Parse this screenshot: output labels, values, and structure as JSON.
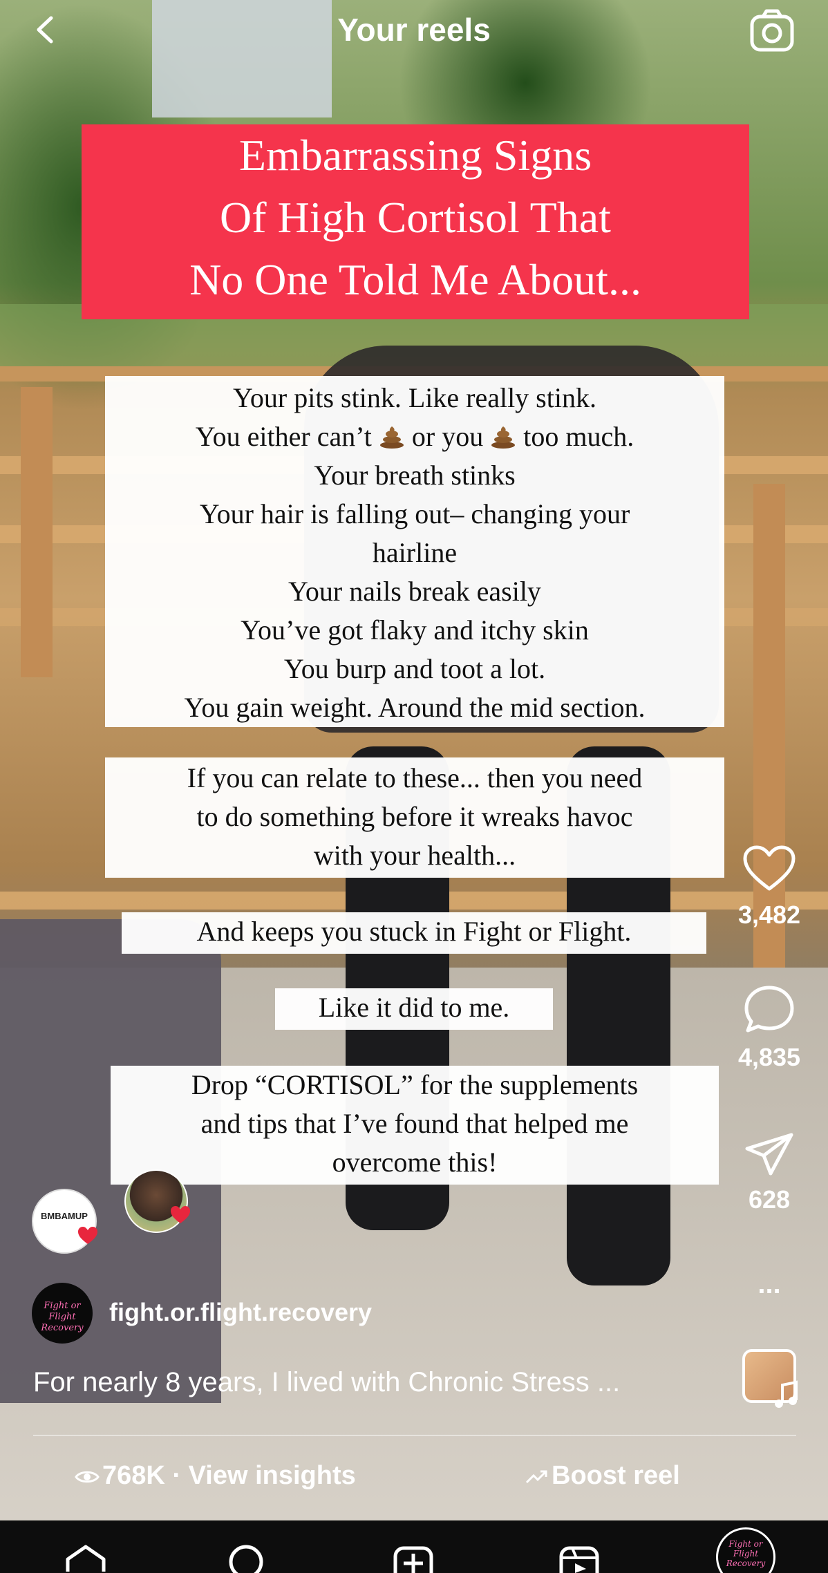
{
  "header": {
    "title": "Your reels"
  },
  "banner": {
    "lines": [
      "Embarrassing Signs",
      "Of High Cortisol That",
      "No One Told Me About..."
    ]
  },
  "list_box": {
    "lines": [
      "Your pits stink. Like really stink.",
      "You either can’t",
      "or you",
      "too much.",
      "Your breath stinks",
      "Your hair is falling out– changing your",
      "hairline",
      "Your nails break easily",
      "You’ve got flaky and itchy skin",
      "You burp and toot a lot.",
      "You gain weight. Around the mid section."
    ]
  },
  "relate_box": {
    "lines": [
      "If you can relate to these... then you need",
      "to do something before it wreaks havoc",
      "with your health..."
    ]
  },
  "stuck_box": {
    "text": "And keeps you stuck in Fight or Flight."
  },
  "me_box": {
    "text": "Like it did to me."
  },
  "drop_box": {
    "lines": [
      "Drop “CORTISOL” for the supplements",
      "and tips that I’ve found that helped me",
      "overcome this!"
    ]
  },
  "actions": {
    "likes": "3,482",
    "comments": "4,835",
    "shares": "628",
    "more": "..."
  },
  "collab_avatars": {
    "left_logo_text": "BMBAMUP"
  },
  "account": {
    "avatar_text_1": "Fight or Flight",
    "avatar_text_2": "Recovery",
    "username": "fight.or.flight.recovery"
  },
  "caption": "For nearly 8 years, I lived with Chronic Stress ...",
  "footer": {
    "insights": "768K · View insights",
    "boost": "Boost reel"
  },
  "nav": {
    "avatar_text_1": "Fight or Flight",
    "avatar_text_2": "Recovery"
  },
  "colors": {
    "banner": "#f5344c",
    "heart_badge": "#e8263d",
    "nav_bg": "#0d0d0d"
  },
  "icons": [
    "back-chevron-icon",
    "camera-icon",
    "heart-icon",
    "comment-icon",
    "share-icon",
    "more-icon",
    "music-icon",
    "eye-icon",
    "trend-icon",
    "home-icon",
    "search-icon",
    "create-icon",
    "reels-icon"
  ]
}
